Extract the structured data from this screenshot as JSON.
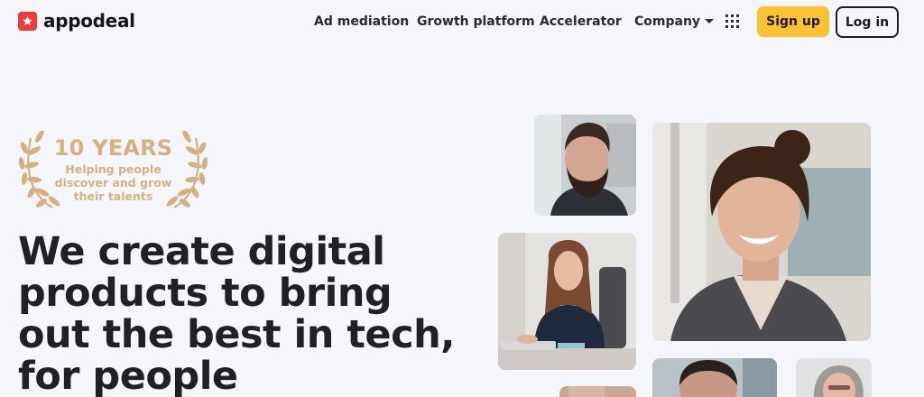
{
  "brand": {
    "name": "appodeal",
    "logo_color": "#ee3a3a"
  },
  "nav": {
    "links": [
      "Ad mediation",
      "Growth platform",
      "Accelerator",
      "Company"
    ],
    "company_dropdown_icon": "caret-down-icon",
    "apps_icon": "grid-icon",
    "signup_label": "Sign up",
    "login_label": "Log in",
    "signup_color": "#fbc232"
  },
  "badge": {
    "title": "10 YEARS",
    "subtitle_lines": [
      "Helping people",
      "discover and grow",
      "their talents"
    ],
    "color": "#d4b27f",
    "icon": "laurel-wreath-icon"
  },
  "hero": {
    "headline_lines": [
      "We create digital",
      "products to bring",
      "out the best in tech,",
      "for people"
    ]
  },
  "photos": [
    "photo-man-bearded",
    "photo-woman-laptop",
    "photo-woman-smiling",
    "photo-man-partial",
    "photo-woman-gray-hair-partial",
    "photo-partial-bottom"
  ]
}
